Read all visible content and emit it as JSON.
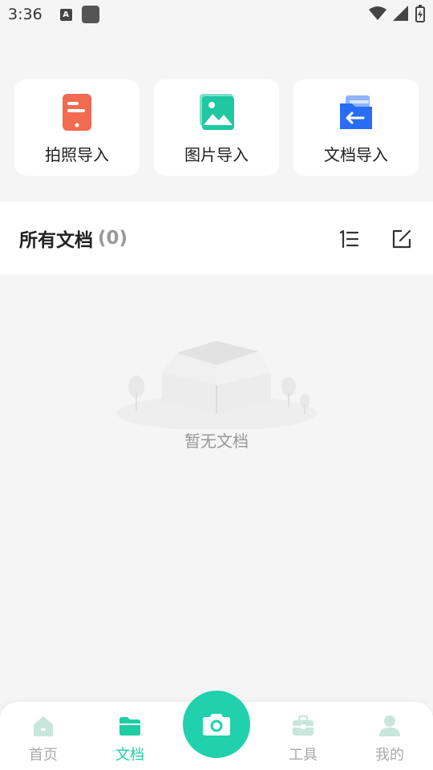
{
  "status_bar": {
    "time": "3:36",
    "notif_letter": "A"
  },
  "import_cards": [
    {
      "label": "拍照导入",
      "icon": "phone-capture-icon"
    },
    {
      "label": "图片导入",
      "icon": "image-icon"
    },
    {
      "label": "文档导入",
      "icon": "folder-import-icon"
    }
  ],
  "docs": {
    "title": "所有文档",
    "count": "(0)",
    "empty_text": "暂无文档"
  },
  "tabbar": {
    "tabs": [
      {
        "label": "首页",
        "icon": "home-icon",
        "active": false
      },
      {
        "label": "文档",
        "icon": "folder-icon",
        "active": true
      },
      {
        "label": "工具",
        "icon": "toolbox-icon",
        "active": false
      },
      {
        "label": "我的",
        "icon": "user-icon",
        "active": false
      }
    ],
    "fab_icon": "camera-icon"
  },
  "colors": {
    "accent": "#21d1ad",
    "background": "#f5f5f5"
  }
}
